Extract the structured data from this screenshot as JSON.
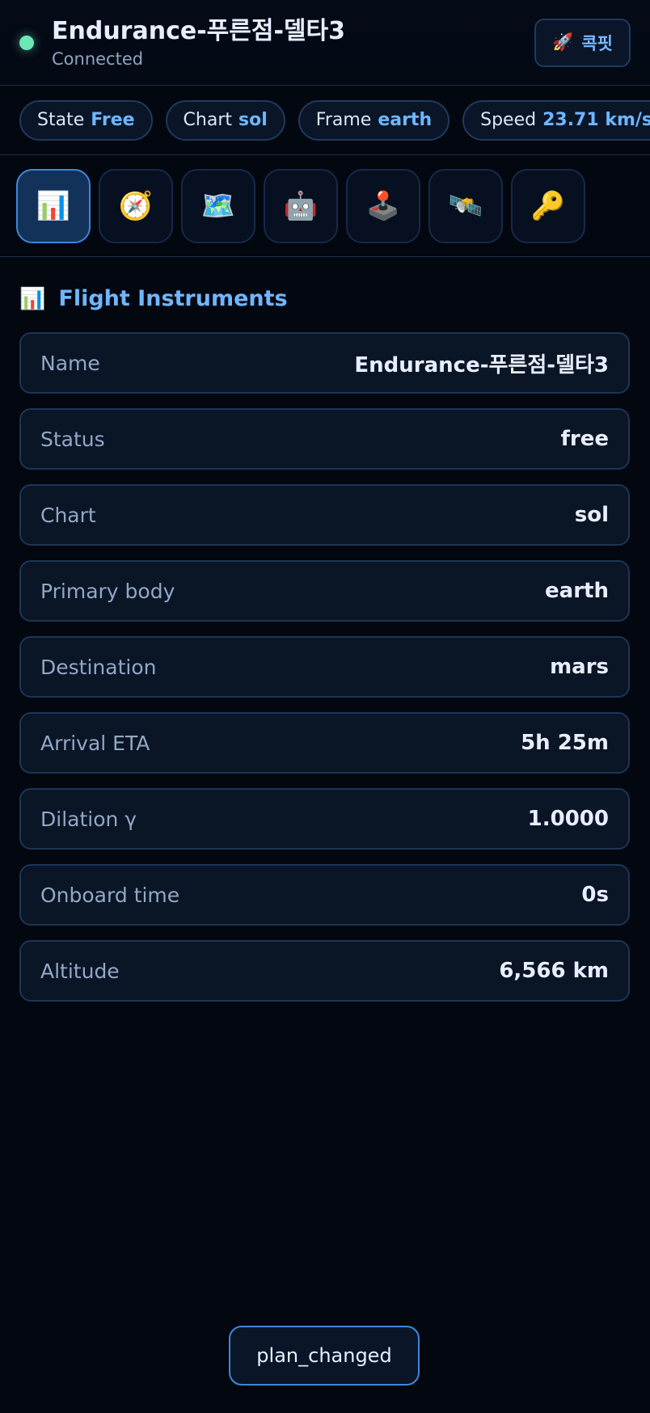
{
  "header": {
    "title": "Endurance-푸른점-델타3",
    "status": "Connected",
    "status_color": "#6ee7b7",
    "cockpit_icon": "rocket-icon",
    "cockpit_label": "콕핏"
  },
  "chips": [
    {
      "label": "State",
      "value": "Free"
    },
    {
      "label": "Chart",
      "value": "sol"
    },
    {
      "label": "Frame",
      "value": "earth"
    },
    {
      "label": "Speed",
      "value": "23.71 km/s"
    }
  ],
  "tabs": [
    {
      "icon": "📊",
      "name": "bar-chart-icon",
      "active": true
    },
    {
      "icon": "🧭",
      "name": "compass-icon",
      "active": false
    },
    {
      "icon": "🗺️",
      "name": "map-icon",
      "active": false
    },
    {
      "icon": "🤖",
      "name": "robot-icon",
      "active": false
    },
    {
      "icon": "🕹️",
      "name": "joystick-icon",
      "active": false
    },
    {
      "icon": "🛰️",
      "name": "satellite-icon",
      "active": false
    },
    {
      "icon": "🔑",
      "name": "key-icon",
      "active": false
    }
  ],
  "section": {
    "icon": "📊",
    "title": "Flight Instruments",
    "rows": [
      {
        "label": "Name",
        "value": "Endurance-푸른점-델타3"
      },
      {
        "label": "Status",
        "value": "free"
      },
      {
        "label": "Chart",
        "value": "sol"
      },
      {
        "label": "Primary body",
        "value": "earth"
      },
      {
        "label": "Destination",
        "value": "mars"
      },
      {
        "label": "Arrival ETA",
        "value": "5h 25m"
      },
      {
        "label": "Dilation γ",
        "value": "1.0000"
      },
      {
        "label": "Onboard time",
        "value": "0s"
      },
      {
        "label": "Altitude",
        "value": "6,566 km"
      }
    ]
  },
  "toast": {
    "text": "plan_changed"
  },
  "colors": {
    "accent": "#6fb6ff",
    "background": "#03070f",
    "active_tab": "#12325a"
  }
}
